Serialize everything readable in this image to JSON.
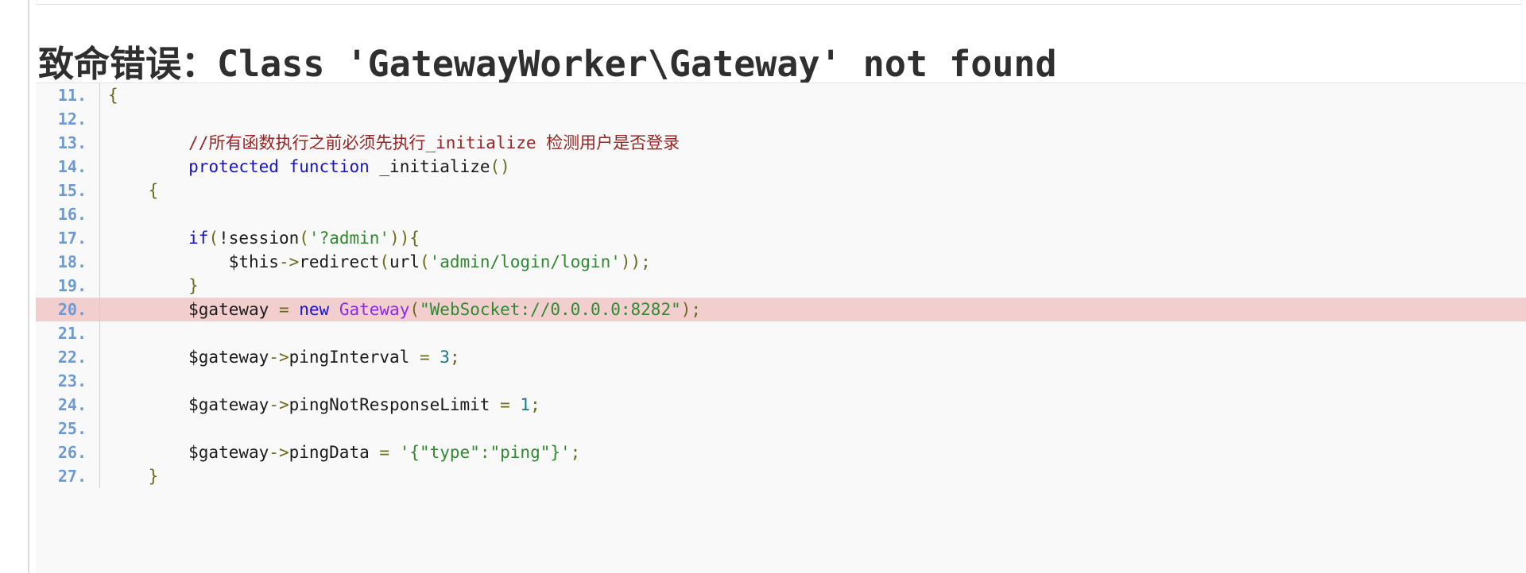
{
  "error": {
    "title": "致命错误：Class 'GatewayWorker\\Gateway' not found"
  },
  "code_panel": {
    "highlight_line": 20,
    "lines": [
      {
        "no": "11.",
        "tokens": [
          {
            "t": "punc",
            "s": "{"
          }
        ]
      },
      {
        "no": "12.",
        "tokens": []
      },
      {
        "no": "13.",
        "tokens": [
          {
            "t": "plain",
            "s": "        "
          },
          {
            "t": "cmt",
            "s": "//所有函数执行之前必须先执行_initialize 检测用户是否登录"
          }
        ]
      },
      {
        "no": "14.",
        "tokens": [
          {
            "t": "plain",
            "s": "        "
          },
          {
            "t": "kw",
            "s": "protected"
          },
          {
            "t": "plain",
            "s": " "
          },
          {
            "t": "kw",
            "s": "function"
          },
          {
            "t": "plain",
            "s": " _initialize"
          },
          {
            "t": "punc",
            "s": "()"
          }
        ]
      },
      {
        "no": "15.",
        "tokens": [
          {
            "t": "plain",
            "s": "    "
          },
          {
            "t": "punc",
            "s": "{"
          }
        ]
      },
      {
        "no": "16.",
        "tokens": []
      },
      {
        "no": "17.",
        "tokens": [
          {
            "t": "plain",
            "s": "        "
          },
          {
            "t": "kw",
            "s": "if"
          },
          {
            "t": "punc",
            "s": "("
          },
          {
            "t": "plain",
            "s": "!session"
          },
          {
            "t": "punc",
            "s": "("
          },
          {
            "t": "str",
            "s": "'?admin'"
          },
          {
            "t": "punc",
            "s": ")){"
          }
        ]
      },
      {
        "no": "18.",
        "tokens": [
          {
            "t": "plain",
            "s": "            $this"
          },
          {
            "t": "op",
            "s": "->"
          },
          {
            "t": "plain",
            "s": "redirect"
          },
          {
            "t": "punc",
            "s": "("
          },
          {
            "t": "plain",
            "s": "url"
          },
          {
            "t": "punc",
            "s": "("
          },
          {
            "t": "str",
            "s": "'admin/login/login'"
          },
          {
            "t": "punc",
            "s": "));"
          }
        ]
      },
      {
        "no": "19.",
        "tokens": [
          {
            "t": "plain",
            "s": "        "
          },
          {
            "t": "punc",
            "s": "}"
          }
        ]
      },
      {
        "no": "20.",
        "tokens": [
          {
            "t": "plain",
            "s": "        $gateway "
          },
          {
            "t": "op",
            "s": "="
          },
          {
            "t": "plain",
            "s": " "
          },
          {
            "t": "kw",
            "s": "new"
          },
          {
            "t": "plain",
            "s": " "
          },
          {
            "t": "cls",
            "s": "Gateway"
          },
          {
            "t": "punc",
            "s": "("
          },
          {
            "t": "str",
            "s": "\"WebSocket://0.0.0.0:8282\""
          },
          {
            "t": "punc",
            "s": ");"
          }
        ]
      },
      {
        "no": "21.",
        "tokens": []
      },
      {
        "no": "22.",
        "tokens": [
          {
            "t": "plain",
            "s": "        $gateway"
          },
          {
            "t": "op",
            "s": "->"
          },
          {
            "t": "plain",
            "s": "pingInterval "
          },
          {
            "t": "op",
            "s": "="
          },
          {
            "t": "plain",
            "s": " "
          },
          {
            "t": "num",
            "s": "3"
          },
          {
            "t": "punc",
            "s": ";"
          }
        ]
      },
      {
        "no": "23.",
        "tokens": []
      },
      {
        "no": "24.",
        "tokens": [
          {
            "t": "plain",
            "s": "        $gateway"
          },
          {
            "t": "op",
            "s": "->"
          },
          {
            "t": "plain",
            "s": "pingNotResponseLimit "
          },
          {
            "t": "op",
            "s": "="
          },
          {
            "t": "plain",
            "s": " "
          },
          {
            "t": "num",
            "s": "1"
          },
          {
            "t": "punc",
            "s": ";"
          }
        ]
      },
      {
        "no": "25.",
        "tokens": []
      },
      {
        "no": "26.",
        "tokens": [
          {
            "t": "plain",
            "s": "        $gateway"
          },
          {
            "t": "op",
            "s": "->"
          },
          {
            "t": "plain",
            "s": "pingData "
          },
          {
            "t": "op",
            "s": "="
          },
          {
            "t": "plain",
            "s": " "
          },
          {
            "t": "str",
            "s": "'{\"type\":\"ping\"}'"
          },
          {
            "t": "punc",
            "s": ";"
          }
        ]
      },
      {
        "no": "27.",
        "tokens": [
          {
            "t": "plain",
            "s": "    "
          },
          {
            "t": "punc",
            "s": "}"
          }
        ]
      }
    ]
  },
  "colors": {
    "highlight_background": "#f2cece",
    "panel_background": "#f9f9f9",
    "line_number": "#6d9ad1",
    "keyword": "#1515cc",
    "string": "#2f8a2f",
    "comment": "#9b2323",
    "class_name": "#8a2be2",
    "number": "#1b7a86",
    "punctuation": "#6b6b1f",
    "title": "#2f2f2f"
  }
}
